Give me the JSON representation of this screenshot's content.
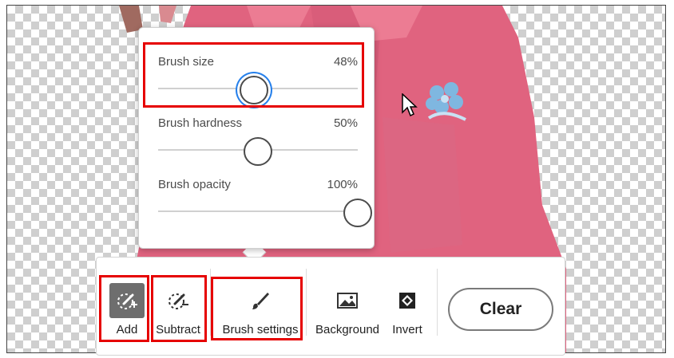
{
  "popover": {
    "sliders": [
      {
        "label": "Brush size",
        "value_text": "48%",
        "value": 48,
        "focused": true
      },
      {
        "label": "Brush hardness",
        "value_text": "50%",
        "value": 50,
        "focused": false
      },
      {
        "label": "Brush opacity",
        "value_text": "100%",
        "value": 100,
        "focused": false
      }
    ]
  },
  "toolbar": {
    "add_label": "Add",
    "subtract_label": "Subtract",
    "brush_settings_label": "Brush settings",
    "background_label": "Background",
    "invert_label": "Invert",
    "clear_label": "Clear"
  },
  "icons": {
    "add": "brush-add-icon",
    "subtract": "brush-subtract-icon",
    "brush_settings": "paintbrush-icon",
    "background": "image-icon",
    "invert": "invert-icon",
    "cursor": "mouse-pointer-icon"
  },
  "colors": {
    "highlight": "#e60000",
    "focus_ring": "#2680eb",
    "shirt": "#e0637f"
  }
}
